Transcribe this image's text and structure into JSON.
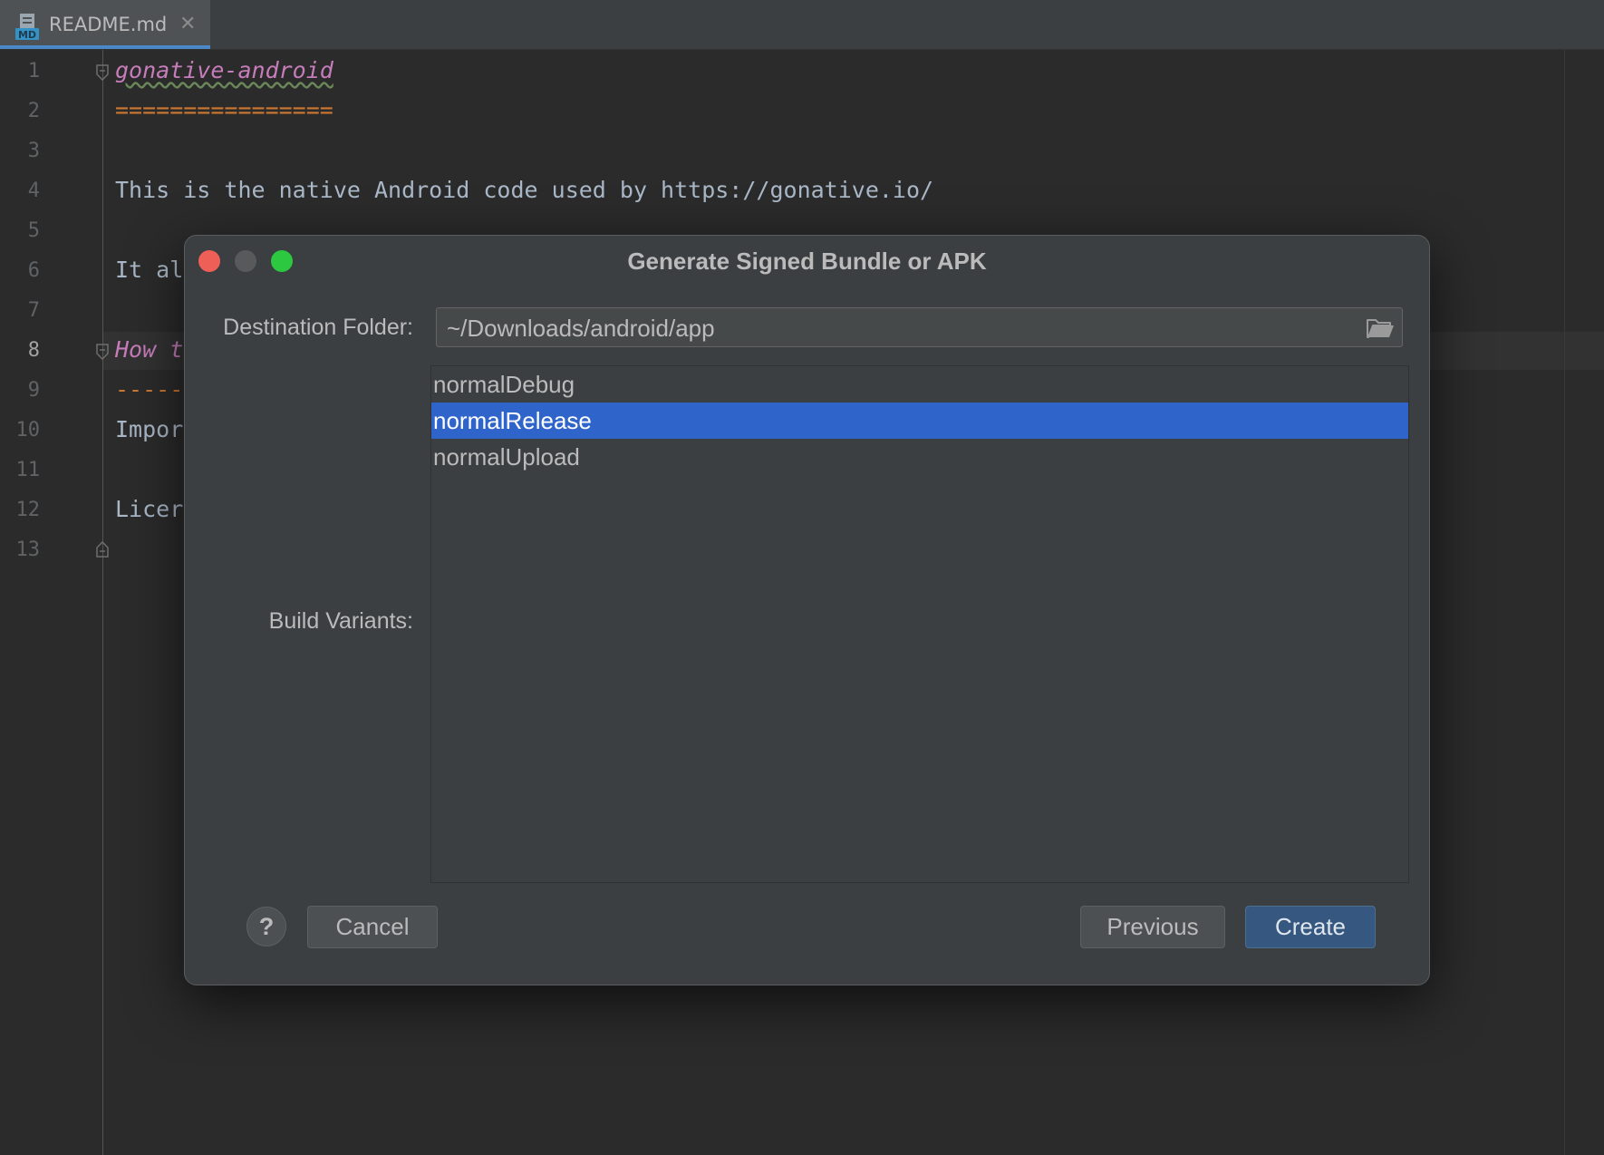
{
  "tab": {
    "icon": "markdown-file-icon",
    "label": "README.md",
    "close": "✕"
  },
  "editor": {
    "line_numbers": [
      "1",
      "2",
      "3",
      "4",
      "5",
      "6",
      "7",
      "8",
      "9",
      "10",
      "11",
      "12",
      "13"
    ],
    "current_line": "8",
    "lines": {
      "l1": "gonative-android",
      "l2": "================",
      "l4": "This is the native Android code used by https://gonative.io/",
      "l6": "It al",
      "l8": "How t",
      "l9": "-----",
      "l10": "Impor",
      "l12": "Licer"
    },
    "colors": {
      "heading": "#c77dbb",
      "underline": "#cc7832",
      "text": "#a9b7c6"
    }
  },
  "dialog": {
    "title": "Generate Signed Bundle or APK",
    "traffic_lights": {
      "close": "#ee5f57",
      "minimize": "#58595b",
      "maximize": "#2bc840"
    },
    "destination_label": "Destination Folder:",
    "destination_value": "~/Downloads/android/app",
    "folder_icon": "folder-open-icon",
    "variants_label": "Build Variants:",
    "variants": [
      {
        "name": "normalDebug",
        "selected": false
      },
      {
        "name": "normalRelease",
        "selected": true
      },
      {
        "name": "normalUpload",
        "selected": false
      }
    ],
    "help_label": "?",
    "cancel_label": "Cancel",
    "previous_label": "Previous",
    "create_label": "Create",
    "accent": "#2f65ca"
  }
}
